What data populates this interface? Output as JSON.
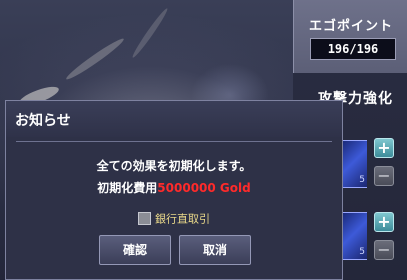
{
  "ego_panel": {
    "title": "エゴポイント",
    "value": "196/196"
  },
  "attack_section": {
    "title": "攻撃力強化",
    "slots": [
      {
        "number": "5",
        "plus": "+",
        "minus": "−"
      },
      {
        "number": "5",
        "plus": "+",
        "minus": "−"
      }
    ]
  },
  "dialog": {
    "title": "お知らせ",
    "message": "全ての効果を初期化します。",
    "cost_label": "初期化費用",
    "cost_value": "5000000 Gold",
    "checkbox_label": "銀行直取引",
    "checkbox_checked": false,
    "confirm_label": "確認",
    "cancel_label": "取消"
  },
  "colors": {
    "cost_red": "#ff2a2a",
    "checkbox_label": "#e9d88a",
    "plus_button": "#3d8c9a"
  }
}
